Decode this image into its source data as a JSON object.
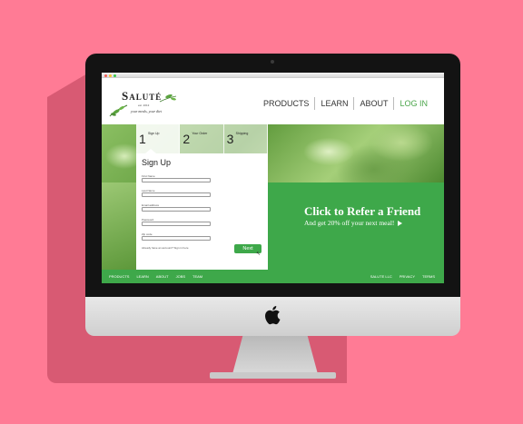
{
  "brand": {
    "name": "Saluté",
    "established": "est. 2013",
    "tagline": "your meals, your diet"
  },
  "nav": {
    "items": [
      "PRODUCTS",
      "LEARN",
      "ABOUT"
    ],
    "login": "LOG IN"
  },
  "steps": [
    {
      "num": "1",
      "label": "Sign Up"
    },
    {
      "num": "2",
      "label": "Your Order"
    },
    {
      "num": "3",
      "label": "Shipping"
    }
  ],
  "form": {
    "title": "Sign Up",
    "fields": [
      "First Name",
      "Last Name",
      "Email address",
      "Password",
      "Zip code"
    ],
    "note": "Already have an account? Sign in here",
    "next": "Next"
  },
  "promo": {
    "title": "Click to Refer a Friend",
    "subtitle": "And  get 20% off your next meal!"
  },
  "footer": {
    "left": [
      "PRODUCTS",
      "LEARN",
      "ABOUT",
      "JOBS",
      "TEAM"
    ],
    "right": [
      "SALUTE LLC",
      "PRIVACY",
      "TERMS"
    ]
  },
  "colors": {
    "background": "#ff7b95",
    "accent_green": "#3ea84a",
    "bezel": "#131313"
  },
  "icons": [
    "apple-logo-icon",
    "play-arrow-icon",
    "cursor-icon",
    "leaf-icon"
  ]
}
